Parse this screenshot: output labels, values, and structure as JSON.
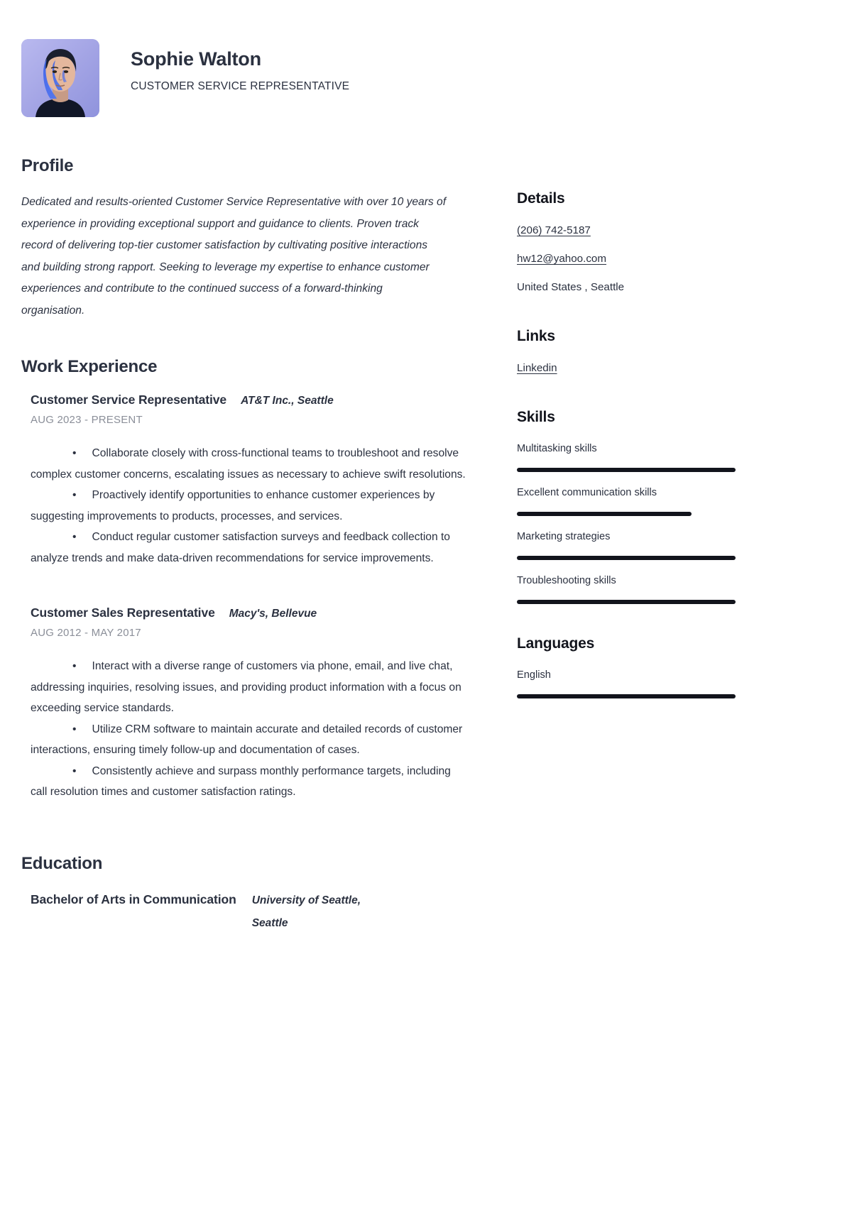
{
  "header": {
    "name": "Sophie Walton",
    "title": "CUSTOMER SERVICE REPRESENTATIVE",
    "avatar_alt": "portrait-photo"
  },
  "profile": {
    "heading": "Profile",
    "text": "Dedicated and results-oriented Customer Service Representative with over 10 years of experience in providing exceptional support and guidance to clients. Proven track record of delivering top-tier customer satisfaction by cultivating positive interactions and building strong rapport. Seeking to leverage my expertise to enhance customer experiences and contribute to the continued success of a forward-thinking organisation."
  },
  "work": {
    "heading": "Work Experience",
    "jobs": [
      {
        "role": "Customer Service Representative",
        "company": "AT&T Inc., Seattle",
        "dates": "AUG 2023 - PRESENT",
        "bullets": [
          "Collaborate closely with cross-functional teams to troubleshoot and resolve complex customer concerns, escalating issues as necessary to achieve swift resolutions.",
          "Proactively identify opportunities to enhance customer experiences by suggesting improvements to products, processes, and services.",
          "Conduct regular customer satisfaction surveys and feedback collection to analyze trends and make data-driven recommendations for service improvements."
        ]
      },
      {
        "role": "Customer Sales Representative",
        "company": "Macy's, Bellevue",
        "dates": "AUG 2012 - MAY 2017",
        "bullets": [
          "Interact with a diverse range of customers via phone, email, and live chat, addressing inquiries, resolving issues, and providing product information with a focus on exceeding service standards.",
          "Utilize CRM software to maintain accurate and detailed records of customer interactions, ensuring timely follow-up and documentation of cases.",
          "Consistently achieve and surpass monthly performance targets, including call resolution times and customer satisfaction ratings."
        ]
      }
    ]
  },
  "education": {
    "heading": "Education",
    "entries": [
      {
        "degree": "Bachelor of Arts in Communication",
        "school": "University of Seattle, Seattle"
      }
    ]
  },
  "details": {
    "heading": "Details",
    "phone": "(206) 742-5187",
    "email": "hw12@yahoo.com",
    "location": "United States , Seattle"
  },
  "links": {
    "heading": "Links",
    "items": [
      {
        "label": "Linkedin"
      }
    ]
  },
  "skills": {
    "heading": "Skills",
    "items": [
      {
        "label": "Multitasking skills",
        "level": 100
      },
      {
        "label": "Excellent communication skills",
        "level": 80
      },
      {
        "label": "Marketing strategies",
        "level": 100
      },
      {
        "label": "Troubleshooting skills",
        "level": 100
      }
    ]
  },
  "languages": {
    "heading": "Languages",
    "items": [
      {
        "label": "English",
        "level": 100
      }
    ]
  },
  "colors": {
    "text": "#2b3140",
    "muted": "#8b8f99",
    "bar": "#12141c",
    "avatar_bg": "#9a9ede"
  }
}
